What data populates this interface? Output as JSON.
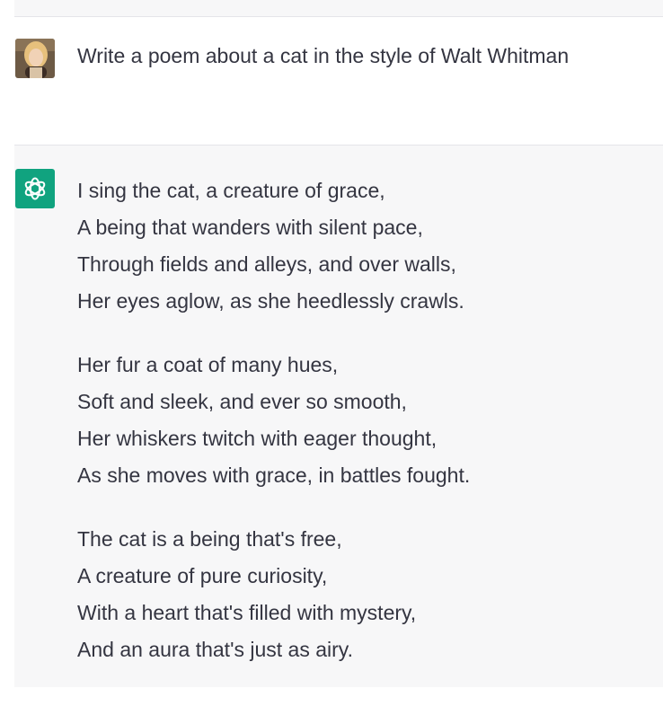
{
  "conversation": {
    "user_message": {
      "text": "Write a poem about a cat in the style of Walt Whitman"
    },
    "assistant_message": {
      "stanzas": [
        {
          "lines": [
            "I sing the cat, a creature of grace,",
            "A being that wanders with silent pace,",
            "Through fields and alleys, and over walls,",
            "Her eyes aglow, as she heedlessly crawls."
          ]
        },
        {
          "lines": [
            "Her fur a coat of many hues,",
            "Soft and sleek, and ever so smooth,",
            "Her whiskers twitch with eager thought,",
            "As she moves with grace, in battles fought."
          ]
        },
        {
          "lines": [
            "The cat is a being that's free,",
            "A creature of pure curiosity,",
            "With a heart that's filled with mystery,",
            "And an aura that's just as airy."
          ]
        }
      ]
    }
  },
  "icons": {
    "user_avatar": "user-photo-avatar",
    "assistant_avatar": "openai-logo-icon"
  },
  "colors": {
    "assistant_background": "#f7f7f8",
    "user_background": "#ffffff",
    "assistant_avatar_bg": "#10a37f",
    "text": "#343541",
    "divider": "#e5e5e9"
  }
}
